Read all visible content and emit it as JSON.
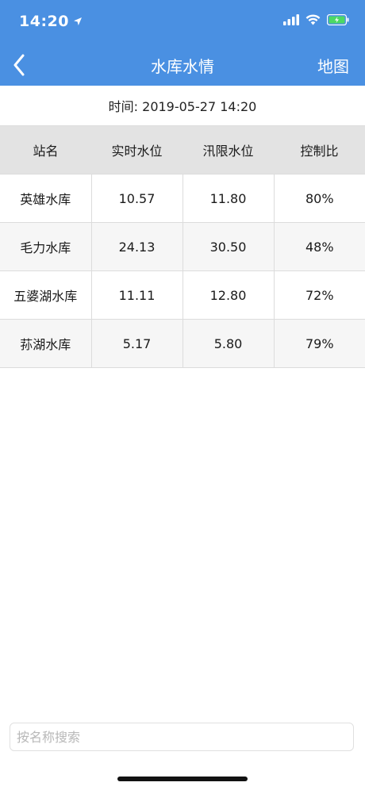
{
  "status_bar": {
    "time": "14:20",
    "location_icon": "location-arrow-icon",
    "signal_icon": "signal-bars-icon",
    "wifi_icon": "wifi-icon",
    "battery_icon": "battery-charging-icon"
  },
  "nav": {
    "back_icon": "chevron-left-icon",
    "title": "水库水情",
    "right_label": "地图"
  },
  "time_label": "时间: 2019-05-27 14:20",
  "table": {
    "headers": [
      "站名",
      "实时水位",
      "汛限水位",
      "控制比"
    ],
    "rows": [
      [
        "英雄水库",
        "10.57",
        "11.80",
        "80%"
      ],
      [
        "毛力水库",
        "24.13",
        "30.50",
        "48%"
      ],
      [
        "五婆湖水库",
        "11.11",
        "12.80",
        "72%"
      ],
      [
        "荪湖水库",
        "5.17",
        "5.80",
        "79%"
      ]
    ]
  },
  "search": {
    "placeholder": "按名称搜索",
    "value": ""
  },
  "colors": {
    "header_bg": "#4a90e2",
    "table_header_bg": "#e3e3e3",
    "battery_fill": "#4cd964"
  }
}
